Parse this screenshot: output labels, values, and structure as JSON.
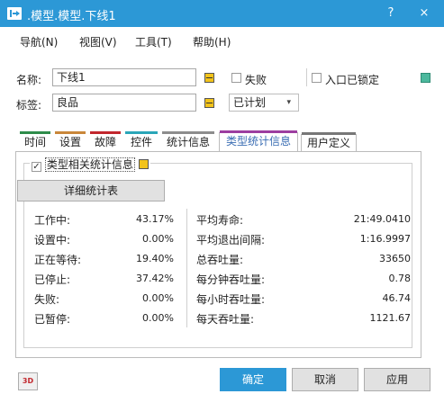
{
  "window": {
    "title": ".模型.模型.下线1",
    "help_label": "?",
    "close_label": "×"
  },
  "menu": [
    "导航(N)",
    "视图(V)",
    "工具(T)",
    "帮助(H)"
  ],
  "form": {
    "name_label": "名称:",
    "name_value": "下线1",
    "failed_label": "失败",
    "entry_locked_label": "入口已锁定",
    "tag_label": "标签:",
    "tag_value": "良品",
    "planned_value": "已计划",
    "planned_arrow": "▾"
  },
  "tabs": [
    {
      "label": "时间",
      "color": "#2e8c4a"
    },
    {
      "label": "设置",
      "color": "#c9873a"
    },
    {
      "label": "故障",
      "color": "#c2272d"
    },
    {
      "label": "控件",
      "color": "#2aa6b8"
    },
    {
      "label": "统计信息",
      "color": "#8d8d8d"
    },
    {
      "label": "类型统计信息",
      "color": "#9c3ea0"
    },
    {
      "label": "用户定义",
      "color": "#777777"
    }
  ],
  "group": {
    "title": "类型相关统计信息",
    "check_mark": "✓",
    "detail_button": "详细统计表"
  },
  "stats_left": [
    {
      "label": "工作中:",
      "value": "43.17%"
    },
    {
      "label": "设置中:",
      "value": "0.00%"
    },
    {
      "label": "正在等待:",
      "value": "19.40%"
    },
    {
      "label": "已停止:",
      "value": "37.42%"
    },
    {
      "label": "失败:",
      "value": "0.00%"
    },
    {
      "label": "已暂停:",
      "value": "0.00%"
    }
  ],
  "stats_right": [
    {
      "label": "平均寿命:",
      "value": "21:49.0410"
    },
    {
      "label": "平均退出间隔:",
      "value": "1:16.9997"
    },
    {
      "label": "总吞吐量:",
      "value": "33650"
    },
    {
      "label": "每分钟吞吐量:",
      "value": "0.78"
    },
    {
      "label": "每小时吞吐量:",
      "value": "46.74"
    },
    {
      "label": "每天吞吐量:",
      "value": "1121.67"
    }
  ],
  "footer": {
    "btn_3d": "3D",
    "ok": "确定",
    "cancel": "取消",
    "apply": "应用"
  }
}
